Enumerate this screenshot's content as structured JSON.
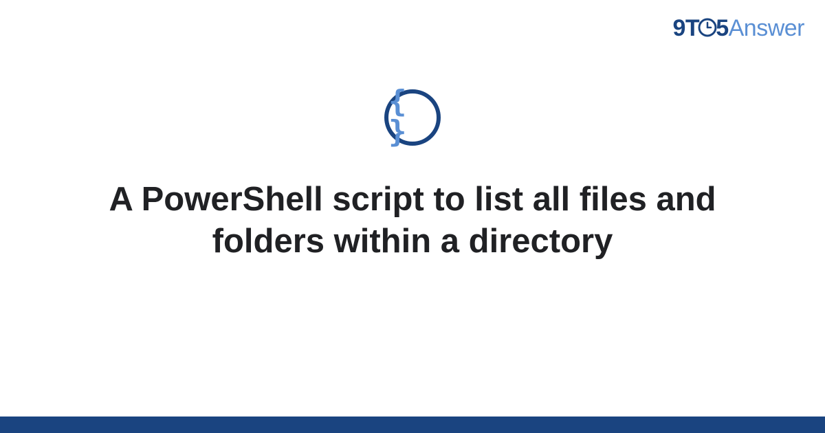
{
  "logo": {
    "part1": "9T",
    "part2": "5",
    "answer": "Answer"
  },
  "icon": {
    "braces": "{ }",
    "name": "code-braces-icon"
  },
  "title": "A PowerShell script to list all files and folders within a directory",
  "colors": {
    "brand_dark": "#1a4480",
    "brand_light": "#5a8fd4",
    "text": "#202124",
    "background": "#ffffff"
  }
}
